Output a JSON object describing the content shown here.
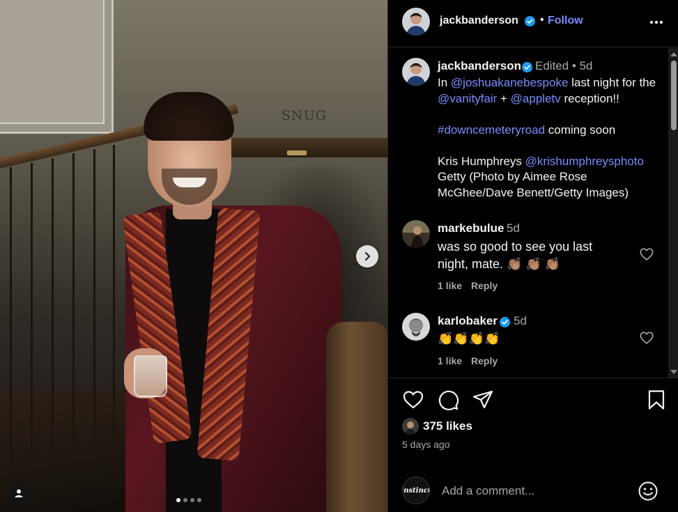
{
  "photo": {
    "sign_text": "SNUG",
    "carousel": {
      "total": 4,
      "active": 0
    }
  },
  "header": {
    "username": "jackbanderson",
    "dot": "•",
    "follow_label": "Follow"
  },
  "caption": {
    "username": "jackbanderson",
    "meta": "Edited • 5d",
    "line1_pre": "In ",
    "mention1": "@joshuakanebespoke",
    "line1_mid": " last night for the ",
    "mention2": "@vanityfair",
    "line1_plus": " + ",
    "mention3": "@appletv",
    "line1_post": " reception!!",
    "hashtag": "#downcemeteryroad",
    "hashtag_post": " coming soon",
    "credit_name": "Kris Humphreys ",
    "credit_mention": "@krishumphreysphoto",
    "credit_rest": " Getty (Photo by Aimee Rose McGhee/Dave Benett/Getty Images)"
  },
  "comments": [
    {
      "username": "markebulue",
      "time": "5d",
      "text": "was so good to see you last night, mate. 👏🏽 👏🏽 👏🏽",
      "likes": "1 like",
      "reply": "Reply"
    },
    {
      "username": "karlobaker",
      "time": "5d",
      "text": "👏👏👏👏",
      "likes": "1 like",
      "reply": "Reply"
    }
  ],
  "post": {
    "likes": "375 likes",
    "ago": "5 days ago"
  },
  "add_comment": {
    "avatar_text": "instinct",
    "placeholder": "Add a comment..."
  },
  "colors": {
    "accent": "#7a8cff",
    "verified": "#1d9bf0",
    "muted": "#a8a8a8",
    "background": "#000000"
  },
  "icons": [
    "more-icon",
    "verified-icon",
    "heart-icon",
    "comment-icon",
    "share-icon",
    "bookmark-icon",
    "emoji-icon",
    "chevron-right-icon",
    "user-tag-icon"
  ]
}
